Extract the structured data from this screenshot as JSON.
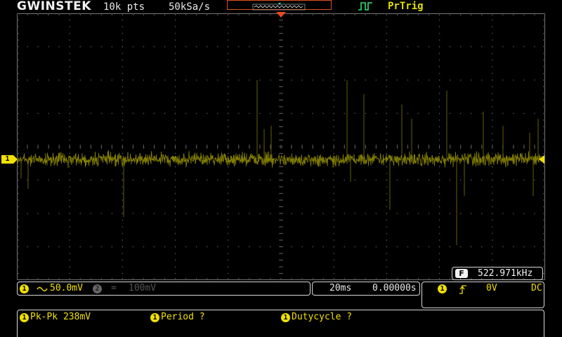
{
  "header": {
    "brand": "GWINSTEK",
    "record_length": "10k pts",
    "sample_rate": "50kSa/s",
    "trigger_status": "PrTrig"
  },
  "colors": {
    "ch1": "#f0e000",
    "accent": "#e0521d",
    "grid": "#5a5a5a",
    "ch2": "#555555"
  },
  "icons": {
    "trigger_mode": "pulse-trigger-icon",
    "coupling": "ac-coupling-icon",
    "trigger_slope": "rising-edge-icon"
  },
  "channels": {
    "ch1": {
      "id": "1",
      "coupling": "~",
      "scale": "50.0mV"
    },
    "ch2": {
      "id": "2",
      "coupling": "=",
      "scale": "100mV"
    }
  },
  "timebase": {
    "scale": "20ms",
    "position": "0.00000s"
  },
  "trigger": {
    "source": "1",
    "level": "0V",
    "coupling": "DC"
  },
  "frequency": {
    "badge": "F",
    "value": "522.971kHz"
  },
  "measurements": [
    {
      "source": "1",
      "label": "Pk-Pk 238mV"
    },
    {
      "source": "1",
      "label": "Period ?"
    },
    {
      "source": "1",
      "label": "Dutycycle ?"
    }
  ]
}
